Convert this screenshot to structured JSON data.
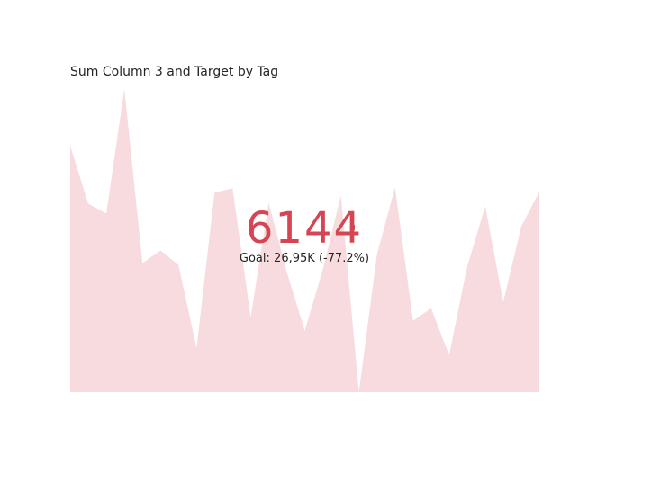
{
  "visual": {
    "title": "Sum Column 3 and Target by Tag"
  },
  "kpi": {
    "value": "6144",
    "status_flag": "!",
    "goal_label": "Goal:",
    "goal_value": "26,95K",
    "goal_diff": "(-77.2%)",
    "status_color": "#d64554"
  },
  "chart_data": {
    "type": "area",
    "title": "Sum Column 3 and Target by Tag",
    "xlabel": "",
    "ylabel": "",
    "ylim": [
      0,
      34000
    ],
    "grid": false,
    "legend": "none",
    "fill_color": "#f7dbdf",
    "series": [
      {
        "values": [
          27300,
          20900,
          19800,
          33600,
          14300,
          15700,
          14100,
          4900,
          22100,
          22600,
          8300,
          21000,
          13300,
          6800,
          13600,
          21800,
          0,
          15300,
          22700,
          7900,
          9300,
          4100,
          13900,
          20600,
          10000,
          18400,
          22200
        ]
      }
    ]
  }
}
